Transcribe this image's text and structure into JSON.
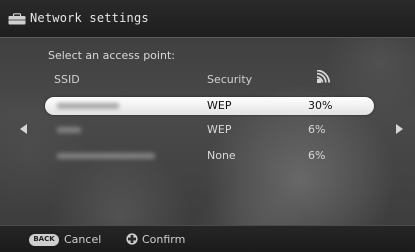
{
  "window": {
    "title": "Network settings",
    "title_icon": "toolbox-icon"
  },
  "main": {
    "prompt": "Select an access point:",
    "columns": {
      "ssid": "SSID",
      "security": "Security",
      "signal_icon": "wifi-signal-icon"
    },
    "access_points": [
      {
        "ssid_blurred": true,
        "security": "WEP",
        "signal": "30%",
        "selected": true
      },
      {
        "ssid_blurred": true,
        "security": "WEP",
        "signal": "6%",
        "selected": false
      },
      {
        "ssid_blurred": true,
        "security": "None",
        "signal": "6%",
        "selected": false
      }
    ],
    "nav": {
      "left_icon": "arrow-left-icon",
      "right_icon": "arrow-right-icon"
    }
  },
  "footer": {
    "back_button_label": "BACK",
    "cancel_label": "Cancel",
    "confirm_icon": "dpad-icon",
    "confirm_label": "Confirm"
  },
  "colors": {
    "selection_bg": "#ffffff",
    "text": "#d8d8d8",
    "bar_bg": "#1e1e1e"
  }
}
